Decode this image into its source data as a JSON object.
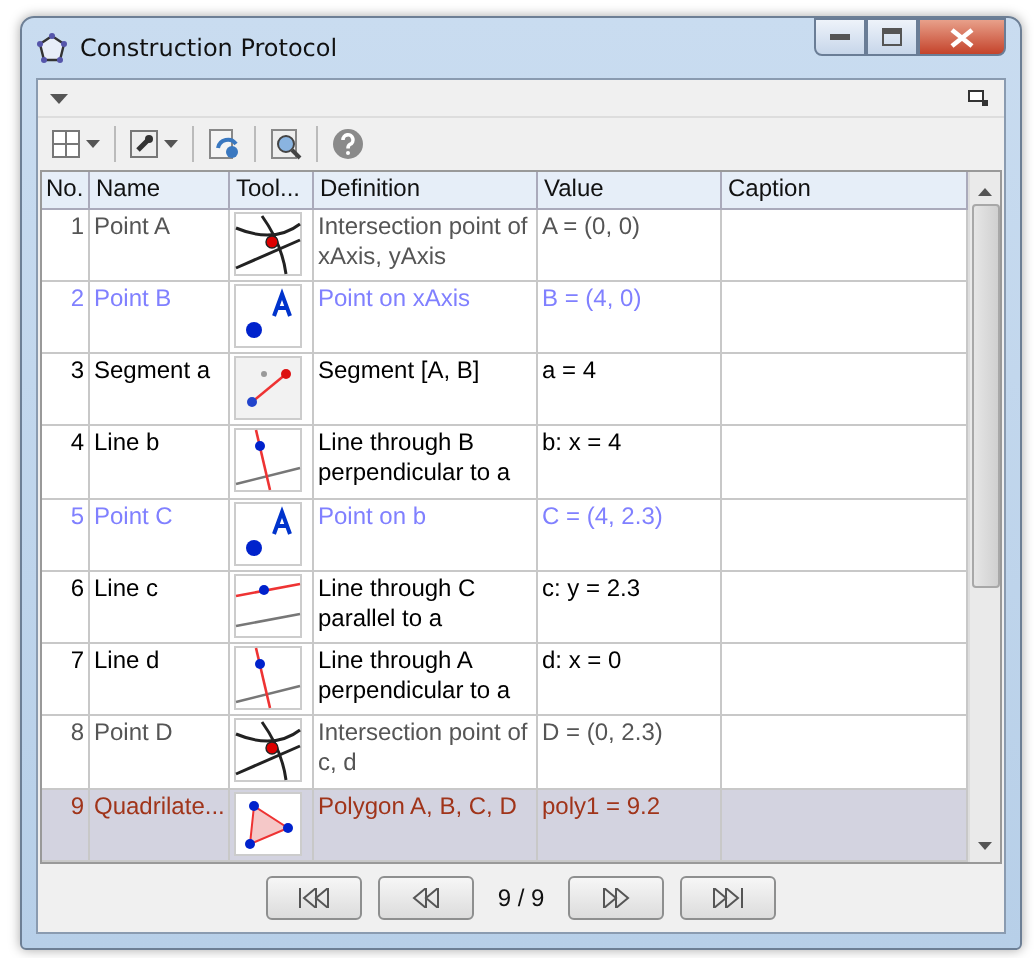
{
  "window": {
    "title": "Construction Protocol"
  },
  "table": {
    "columns": [
      "No.",
      "Name",
      "Tool...",
      "Definition",
      "Value",
      "Caption"
    ],
    "rows": [
      {
        "no": "1",
        "name": "Point A",
        "kind": "intersect",
        "definition": "Intersection point of xAxis, yAxis",
        "value": "A = (0, 0)",
        "color": "#555555",
        "selected": false
      },
      {
        "no": "2",
        "name": "Point B",
        "kind": "point",
        "definition": "Point on xAxis",
        "value": "B = (4, 0)",
        "color": "#8080ff",
        "selected": false
      },
      {
        "no": "3",
        "name": "Segment a",
        "kind": "segment",
        "definition": "Segment [A, B]",
        "value": "a = 4",
        "color": "#000000",
        "selected": false
      },
      {
        "no": "4",
        "name": "Line b",
        "kind": "perpendicular",
        "definition": "Line through B perpendicular to a",
        "value": "b: x = 4",
        "color": "#000000",
        "selected": false
      },
      {
        "no": "5",
        "name": "Point C",
        "kind": "point",
        "definition": "Point on b",
        "value": "C = (4, 2.3)",
        "color": "#8080ff",
        "selected": false
      },
      {
        "no": "6",
        "name": "Line c",
        "kind": "parallel",
        "definition": "Line through C parallel to a",
        "value": "c: y = 2.3",
        "color": "#000000",
        "selected": false
      },
      {
        "no": "7",
        "name": "Line d",
        "kind": "perpendicular",
        "definition": "Line through A perpendicular to a",
        "value": "d: x = 0",
        "color": "#000000",
        "selected": false
      },
      {
        "no": "8",
        "name": "Point D",
        "kind": "intersect",
        "definition": "Intersection point of c, d",
        "value": "D = (0, 2.3)",
        "color": "#555555",
        "selected": false
      },
      {
        "no": "9",
        "name": "Quadrilate...",
        "kind": "polygon",
        "definition": "Polygon A, B, C, D",
        "value": "poly1 = 9.2",
        "color": "#a0341a",
        "selected": true
      }
    ]
  },
  "navigation": {
    "position": "9 / 9"
  }
}
